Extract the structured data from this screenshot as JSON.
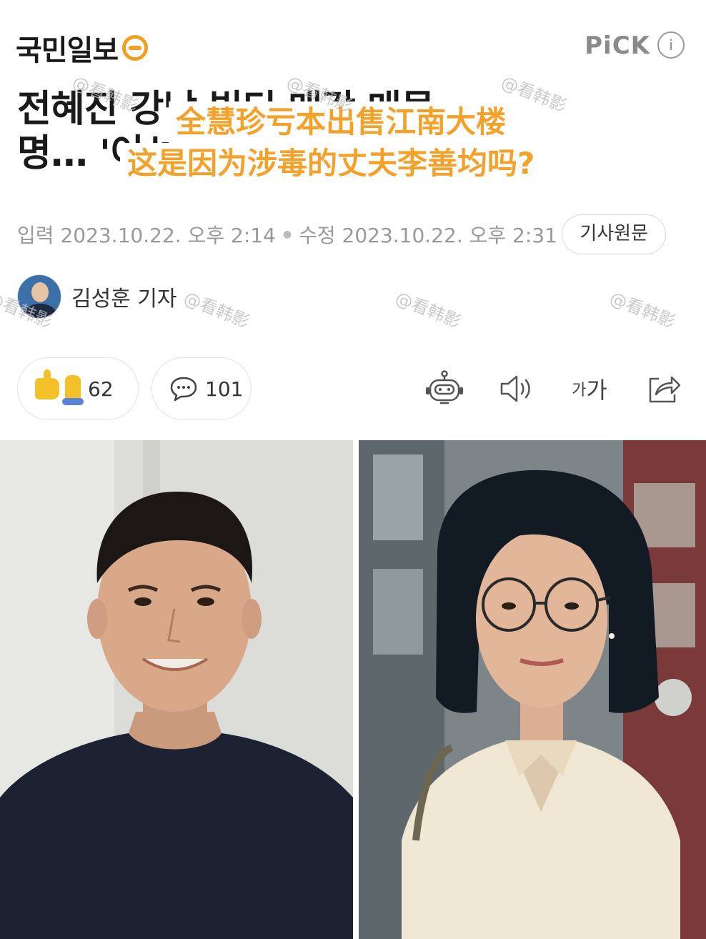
{
  "header": {
    "logo_text": "국민일보",
    "pick_label": "PiCK",
    "info_icon": "i"
  },
  "headline": {
    "line1": "전혜진 강남 빌딩 매각 매물",
    "line2": "명… '이선균 마약' 사건은 때문?"
  },
  "overlay_caption": {
    "line1": "全慧珍亏本出售江南大楼",
    "line2": "这是因为涉毒的丈夫李善均吗?"
  },
  "meta": {
    "input_label": "입력",
    "input_time": "2023.10.22. 오후 2:14",
    "edit_label": "수정",
    "edit_time": "2023.10.22. 오후 2:31",
    "original_button": "기사원문"
  },
  "reporter": {
    "name": "김성훈 기자"
  },
  "watermark": "@看韩影",
  "reactions": {
    "like_count": "62",
    "comment_count": "101"
  },
  "tools": {
    "font_small": "가",
    "font_large": "가"
  },
  "icons": [
    "robot-summary-icon",
    "speaker-icon",
    "font-size-icon",
    "share-icon",
    "speech-bubble-icon",
    "thumbs-up-icon"
  ]
}
